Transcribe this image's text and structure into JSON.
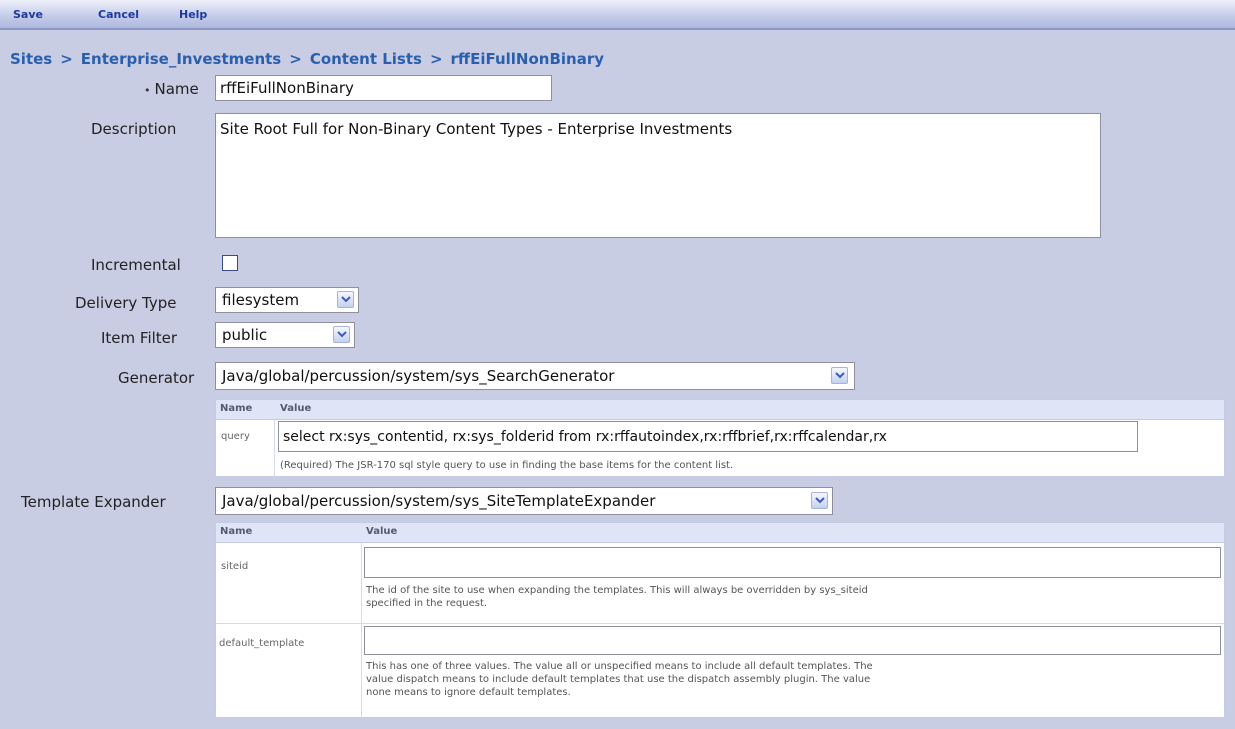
{
  "menu": {
    "save": "Save",
    "cancel": "Cancel",
    "help": "Help"
  },
  "breadcrumb": {
    "sites": "Sites",
    "investments": "Enterprise_Investments",
    "content_lists": "Content Lists",
    "current": "rffEiFullNonBinary",
    "separator": ">"
  },
  "form": {
    "name_label": "Name",
    "name_required_marker": "•",
    "name_value": "rffEiFullNonBinary",
    "description_label": "Description",
    "description_value": "Site Root Full for Non-Binary Content Types - Enterprise Investments",
    "incremental_label": "Incremental",
    "incremental_checked": false,
    "delivery_type_label": "Delivery Type",
    "delivery_type_value": "filesystem",
    "item_filter_label": "Item Filter",
    "item_filter_value": "public",
    "generator_label": "Generator",
    "generator_value": "Java/global/percussion/system/sys_SearchGenerator",
    "template_expander_label": "Template Expander",
    "template_expander_value": "Java/global/percussion/system/sys_SiteTemplateExpander"
  },
  "generator_params": {
    "col_name": "Name",
    "col_value": "Value",
    "rows": [
      {
        "name": "query",
        "value": "select rx:sys_contentid, rx:sys_folderid from rx:rffautoindex,rx:rffbrief,rx:rffcalendar,rx",
        "help": "(Required) The JSR-170 sql style query to use in finding the base items for the content list."
      }
    ]
  },
  "expander_params": {
    "col_name": "Name",
    "col_value": "Value",
    "rows": [
      {
        "name": "siteid",
        "value": "",
        "help_line1": "The id of the site to use when expanding the templates. This will always be overridden by sys_siteid",
        "help_line2": "specified in the request."
      },
      {
        "name": "default_template",
        "value": "",
        "help_line1": "This has one of three values. The value all or unspecified means to include all default templates. The",
        "help_line2": "value dispatch means to include default templates that use the dispatch assembly plugin. The value",
        "help_line3": "none means to ignore default templates."
      }
    ]
  },
  "colors": {
    "background": "#c9cde4",
    "link": "#2a5fae",
    "menu_text": "#1e3a9c"
  }
}
